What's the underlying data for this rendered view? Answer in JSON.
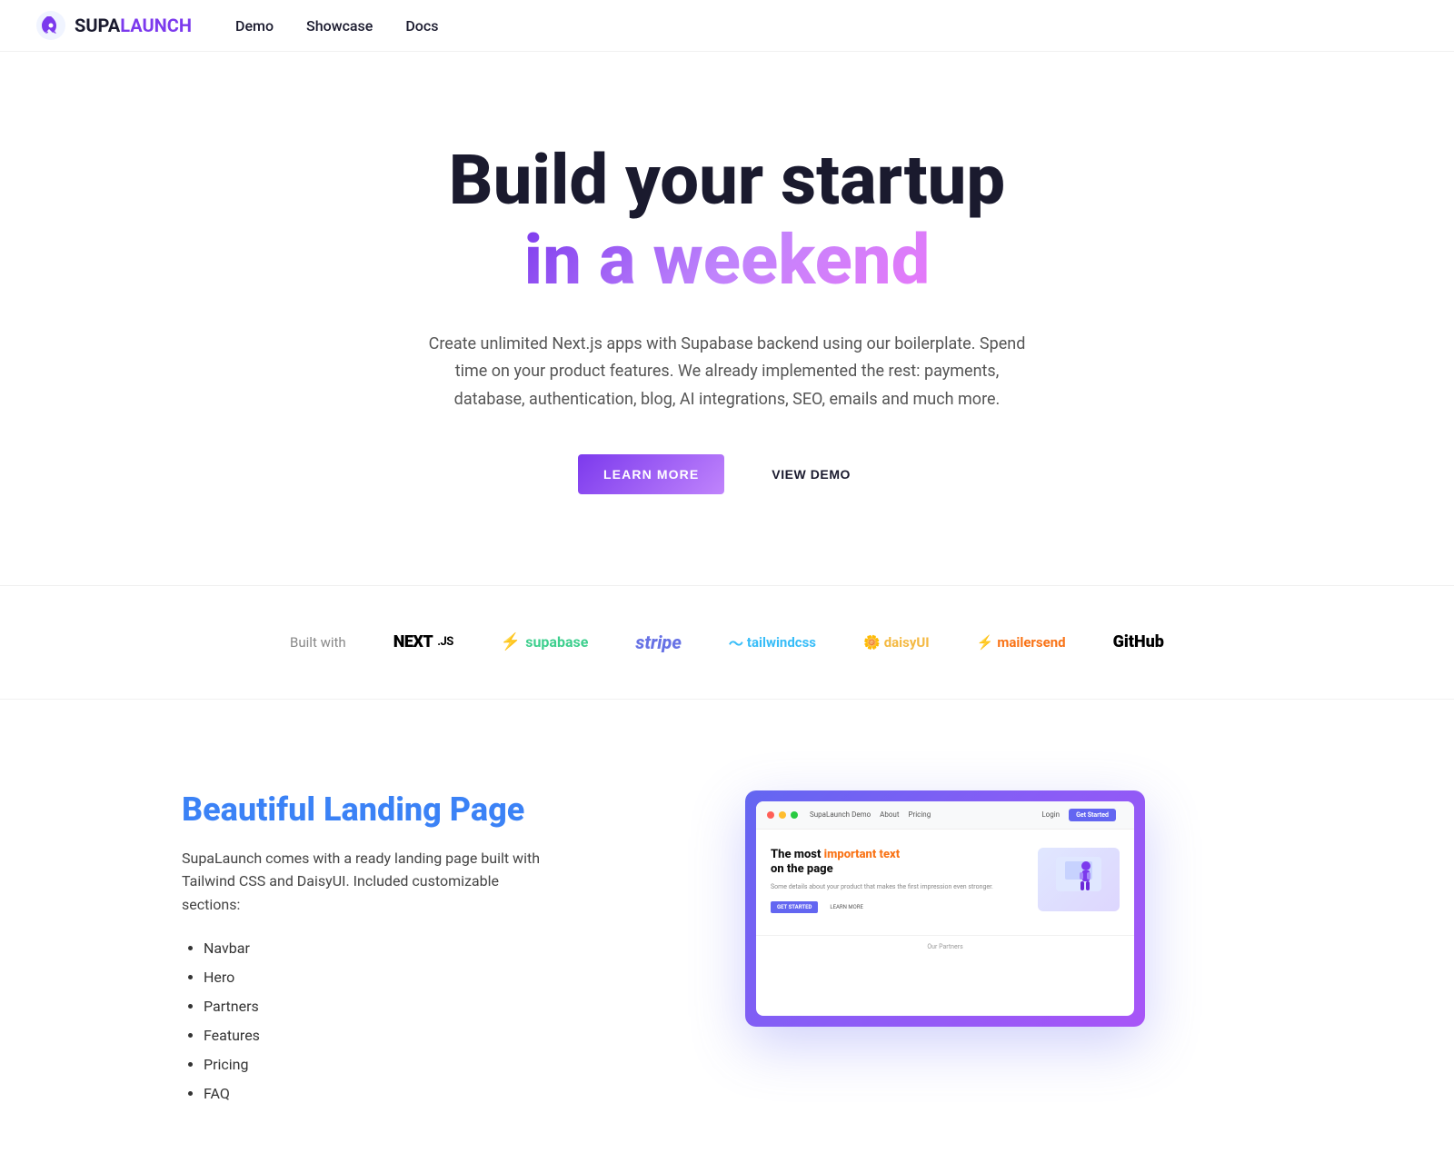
{
  "brand": {
    "name_supa": "SUPA",
    "name_launch": "LAUNCH",
    "logo_alt": "SupaLaunch rocket logo"
  },
  "nav": {
    "links": [
      {
        "label": "Demo",
        "href": "#"
      },
      {
        "label": "Showcase",
        "href": "#"
      },
      {
        "label": "Docs",
        "href": "#"
      }
    ]
  },
  "hero": {
    "title_line1": "Build your startup",
    "title_line2": "in a weekend",
    "description": "Create unlimited Next.js apps with Supabase backend using our boilerplate. Spend time on your product features. We already implemented the rest: payments, database, authentication, blog, AI integrations, SEO, emails and much more.",
    "btn_primary": "LEARN MORE",
    "btn_secondary": "VIEW DEMO"
  },
  "partners": {
    "label": "Built with",
    "items": [
      {
        "name": "Next.js",
        "type": "nextjs"
      },
      {
        "name": "supabase",
        "type": "supabase"
      },
      {
        "name": "stripe",
        "type": "stripe"
      },
      {
        "name": "tailwindcss",
        "type": "tailwind"
      },
      {
        "name": "daisyUI",
        "type": "daisy"
      },
      {
        "name": "mailersend",
        "type": "mailersend"
      },
      {
        "name": "GitHub",
        "type": "github"
      }
    ]
  },
  "features": {
    "title": "Beautiful Landing Page",
    "description": "SupaLaunch comes with a ready landing page built with Tailwind CSS and DaisyUI. Included customizable sections:",
    "list": [
      "Navbar",
      "Hero",
      "Partners",
      "Features",
      "Pricing",
      "FAQ"
    ],
    "mockup": {
      "nav_brand": "SupaLaunch Demo",
      "nav_about": "About",
      "nav_pricing": "Pricing",
      "nav_login": "Login",
      "nav_cta": "Get Started",
      "heading_normal": "The most",
      "heading_accent": "important text",
      "heading_rest": "on the page",
      "subtext": "Some details about your product that makes the first impression even stronger.",
      "btn_primary": "GET STARTED",
      "btn_secondary": "LEARN MORE",
      "partner_footer": "Our Partners"
    }
  }
}
